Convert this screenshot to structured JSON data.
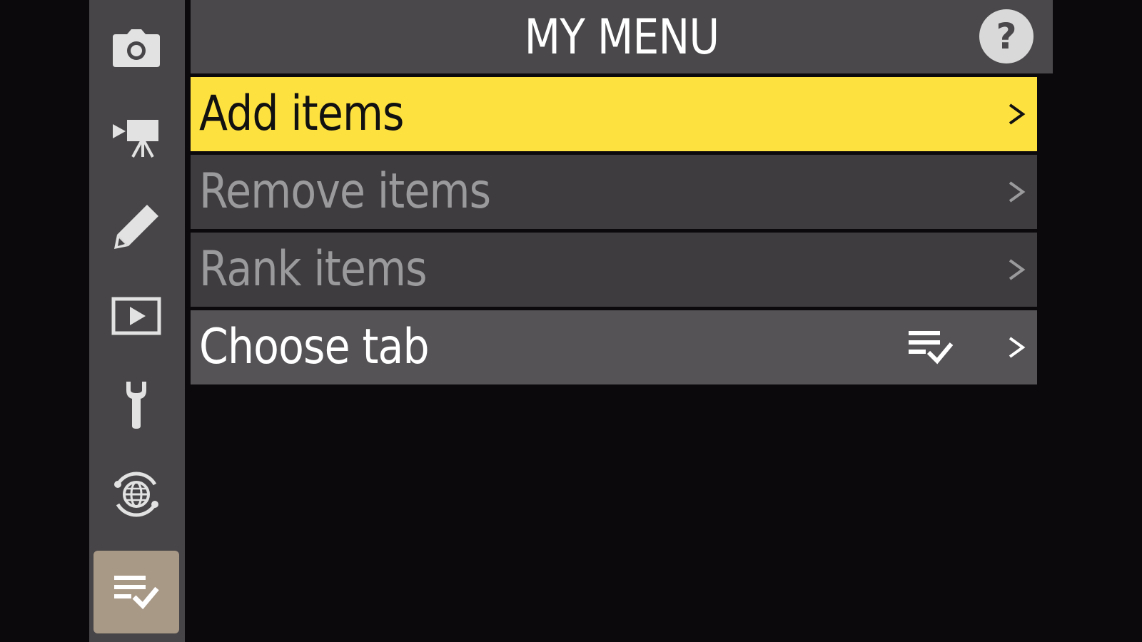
{
  "header": {
    "title": "MY MENU",
    "help_label": "?"
  },
  "rail": {
    "tabs": [
      {
        "icon": "camera-icon",
        "name": "photo-shooting-menu"
      },
      {
        "icon": "movie-camera-icon",
        "name": "video-recording-menu"
      },
      {
        "icon": "pencil-icon",
        "name": "custom-settings-menu"
      },
      {
        "icon": "playback-icon",
        "name": "playback-menu"
      },
      {
        "icon": "wrench-icon",
        "name": "setup-menu"
      },
      {
        "icon": "network-globe-icon",
        "name": "network-menu"
      },
      {
        "icon": "my-menu-list-check-icon",
        "name": "my-menu",
        "active": true
      }
    ]
  },
  "menu": {
    "items": [
      {
        "label": "Add items",
        "state": "selected"
      },
      {
        "label": "Remove items",
        "state": "disabled"
      },
      {
        "label": "Rank items",
        "state": "disabled"
      },
      {
        "label": "Choose tab",
        "state": "enabled",
        "trailing_icon": "my-menu-list-check-icon"
      }
    ]
  },
  "colors": {
    "highlight": "#fde13f",
    "active_tab": "#a89886",
    "rail": "#474547",
    "background": "#0b090b"
  }
}
